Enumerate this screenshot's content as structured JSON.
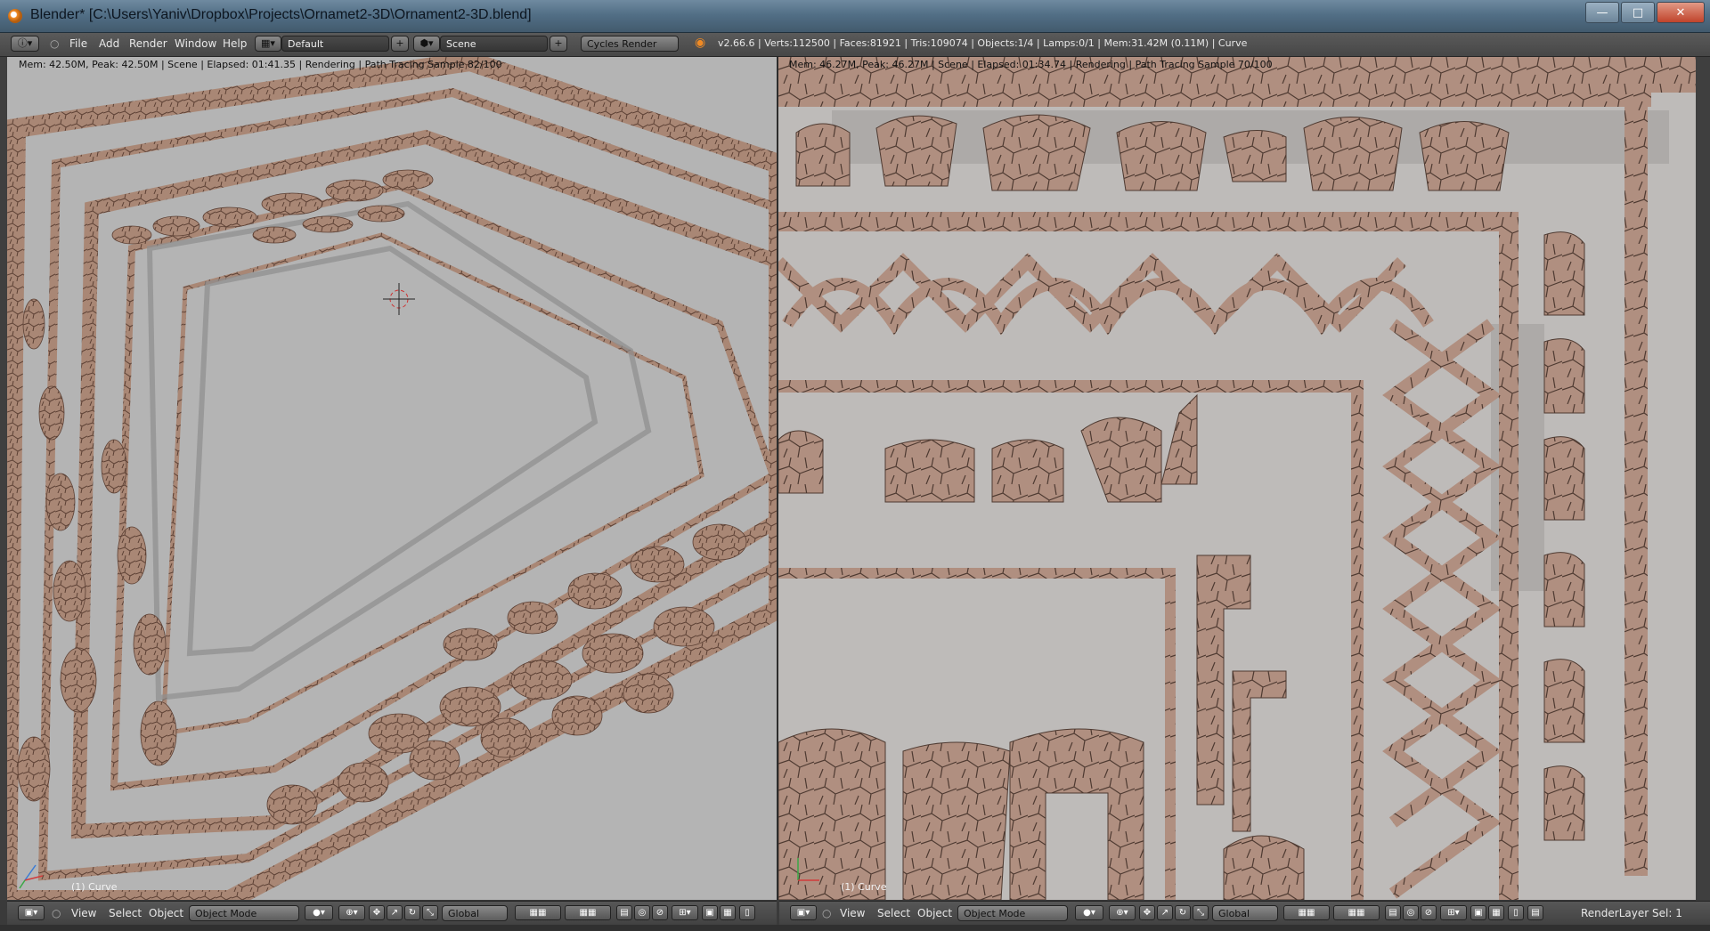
{
  "window": {
    "title": "Blender* [C:\\Users\\Yaniv\\Dropbox\\Projects\\Ornamet2-3D\\Ornament2-3D.blend]",
    "minimize": "—",
    "maximize": "□",
    "close": "✕"
  },
  "header": {
    "menus": [
      "File",
      "Add",
      "Render",
      "Window",
      "Help"
    ],
    "layout": "Default",
    "scene": "Scene",
    "engine": "Cycles Render",
    "info": "v2.66.6 | Verts:112500 | Faces:81921 | Tris:109074 | Objects:1/4 | Lamps:0/1 | Mem:31.42M (0.11M) | Curve"
  },
  "viewport_left": {
    "stats": "Mem: 42.50M, Peak: 42.50M | Scene | Elapsed: 01:41.35 | Rendering | Path Tracing Sample 82/100",
    "object_label": "(1) Curve"
  },
  "viewport_right": {
    "stats": "Mem: 46.27M, Peak: 46.27M | Scene | Elapsed: 01:34.74 | Rendering | Path Tracing Sample 70/100",
    "object_label": "(1) Curve"
  },
  "footer": {
    "view": "View",
    "select": "Select",
    "object": "Object",
    "mode": "Object Mode",
    "orientation": "Global",
    "render_layer": "RenderLayer",
    "sel": "Sel: 1"
  },
  "colors": {
    "ornament": "#a98775",
    "ornament_dark": "#6e5245",
    "floor_left": "#b2b2b2",
    "floor_right": "#bdbab8"
  }
}
